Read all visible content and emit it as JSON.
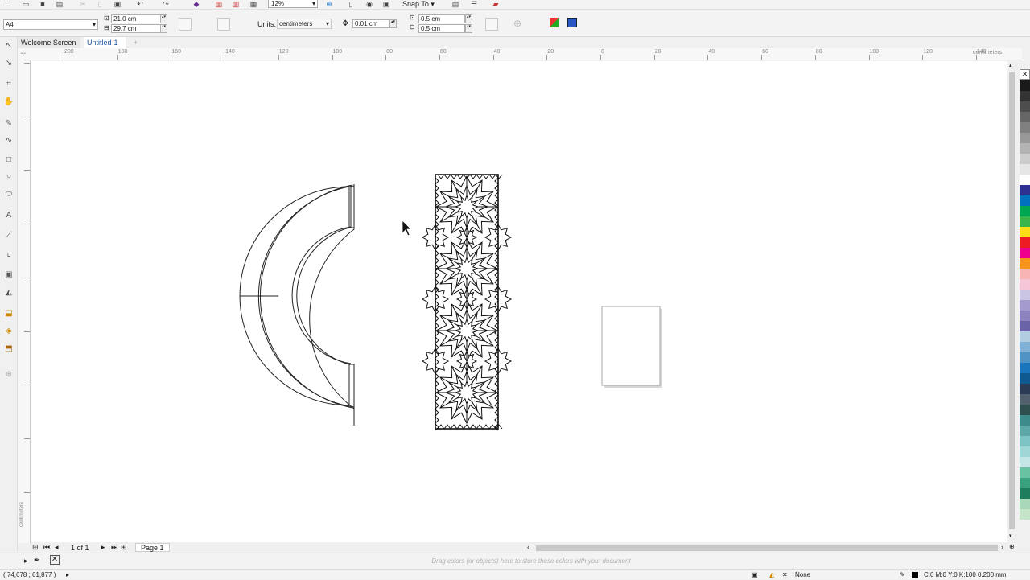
{
  "standard_toolbar": {
    "zoom_value": "12%",
    "snap_to_label": "Snap To"
  },
  "property_bar": {
    "page_size": "A4",
    "width": "21.0 cm",
    "height": "29.7 cm",
    "units_label": "Units:",
    "units_value": "centimeters",
    "nudge": "0.01 cm",
    "dup_x": "0.5 cm",
    "dup_y": "0.5 cm"
  },
  "doc_tabs": [
    {
      "label": "Welcome Screen"
    },
    {
      "label": "Untitled-1"
    }
  ],
  "rulers": {
    "h_ticks": [
      "200",
      "180",
      "160",
      "140",
      "120",
      "100",
      "80",
      "60",
      "40",
      "20",
      "0",
      "20",
      "40",
      "60",
      "80",
      "100",
      "120",
      "140"
    ],
    "units": "centimeters"
  },
  "page_nav": {
    "count": "1 of 1",
    "tab": "Page 1"
  },
  "color_bar": {
    "hint": "Drag colors (or objects) here to store these colors with your document"
  },
  "status_bar": {
    "coords": "( 74,678 ; 61,877 )",
    "fill_label": "None",
    "outline_label": "C:0 M:0 Y:0 K:100  0.200 mm"
  },
  "palette_colors": [
    "#1a1a1a",
    "#333333",
    "#4d4d4d",
    "#666666",
    "#808080",
    "#999999",
    "#b3b3b3",
    "#cccccc",
    "#e6e6e6",
    "#ffffff",
    "#2e3192",
    "#0071bc",
    "#00a651",
    "#39b54a",
    "#ffde17",
    "#ed1c24",
    "#ec008c",
    "#f7941d",
    "#f8b4b4",
    "#f4c6d7",
    "#c9c5e2",
    "#a59ace",
    "#8c83be",
    "#6b63a8",
    "#b3cde0",
    "#7fb2d6",
    "#4f93c5",
    "#1b75bc",
    "#0f5a91",
    "#2b3a55",
    "#53606e",
    "#2f4f4f",
    "#3d8b8b",
    "#5fa8a8",
    "#7fc4c4",
    "#9fd6d6",
    "#c4e6e6",
    "#68c3a3",
    "#3aa17e",
    "#1e7d5c",
    "#a8d8b9",
    "#c6e4c8"
  ]
}
